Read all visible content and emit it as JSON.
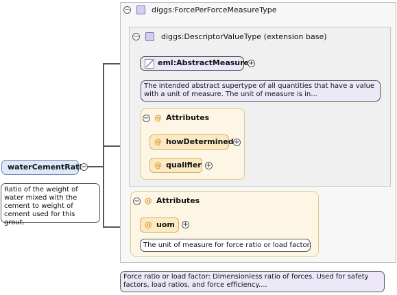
{
  "outer_type": {
    "prefix": "diggs:",
    "name": "ForcePerForceMeasureType"
  },
  "inner_type": {
    "prefix": "diggs:",
    "name": "DescriptorValueType",
    "suffix": " (extension base)"
  },
  "element": {
    "name": "waterCementRatio",
    "doc": "Ratio of the weight of water mixed with the cement to weight of cement used for this grout."
  },
  "abstract_measure": {
    "name": "eml:AbstractMeasure",
    "doc": "The intended abstract supertype of all quantities that have a value with a unit of measure. The unit of measure is in..."
  },
  "inner_attributes": {
    "title": "Attributes",
    "items": [
      "howDetermined",
      "qualifier"
    ]
  },
  "outer_attributes": {
    "title": "Attributes",
    "items": [
      "uom"
    ],
    "uom_doc": "The unit of measure for force ratio or load factor."
  },
  "type_doc": "Force ratio or load factor: Dimensionless ratio of forces. Used for safety factors, load ratios, and force efficiency....",
  "glyphs": {
    "at": "@",
    "minus": "−",
    "plus": "+"
  }
}
